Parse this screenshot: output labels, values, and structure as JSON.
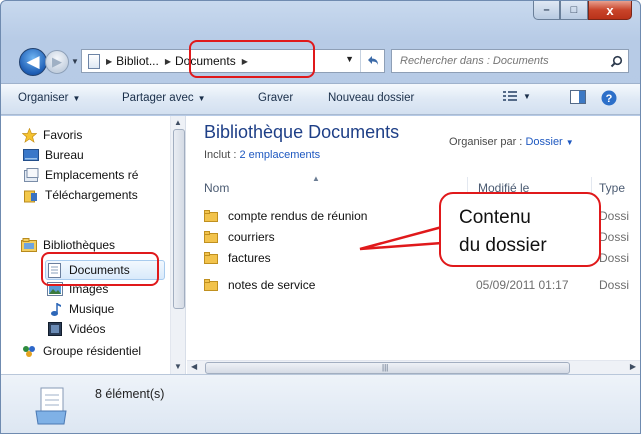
{
  "window": {
    "caption_buttons": {
      "minimize": "–",
      "maximize": "□",
      "close": "x"
    }
  },
  "navigation": {
    "back_glyph": "◀",
    "forward_glyph": "▶",
    "breadcrumbs": [
      "Bibliot...",
      "Documents"
    ],
    "search_placeholder": "Rechercher dans : Documents"
  },
  "toolbar": {
    "organize": "Organiser",
    "share_with": "Partager avec",
    "burn": "Graver",
    "new_folder": "Nouveau dossier"
  },
  "sidebar": {
    "favorites": "Favoris",
    "desktop": "Bureau",
    "recent_places": "Emplacements ré",
    "downloads": "Téléchargements",
    "libraries": "Bibliothèques",
    "documents": "Documents",
    "images": "Images",
    "music": "Musique",
    "videos": "Vidéos",
    "homegroup": "Groupe résidentiel"
  },
  "library": {
    "title": "Bibliothèque Documents",
    "includes_label": "Inclut :",
    "includes_link": "2 emplacements",
    "arrange_label": "Organiser par :",
    "arrange_value": "Dossier"
  },
  "columns": {
    "name": "Nom",
    "modified": "Modifié le",
    "type": "Type"
  },
  "files": [
    {
      "name": "compte rendus de réunion",
      "date": "",
      "type": "Dossi"
    },
    {
      "name": "courriers",
      "date": "",
      "type": "Dossi"
    },
    {
      "name": "factures",
      "date": "",
      "type": "Dossi"
    },
    {
      "name": "notes de service",
      "date": "05/09/2011 01:17",
      "type": "Dossi"
    }
  ],
  "callout": {
    "line1": "Contenu",
    "line2": "du dossier"
  },
  "status": {
    "count": "8 élément(s)"
  },
  "colors": {
    "highlight": "#e0191b",
    "library_title": "#1e3f87",
    "link": "#1e58c0"
  }
}
